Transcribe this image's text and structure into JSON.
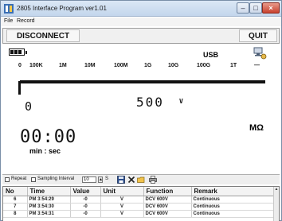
{
  "window": {
    "title": "2805 Interface Program ver1.01"
  },
  "menu": [
    "File",
    "Record"
  ],
  "toolbar": {
    "disconnect_label": "DISCONNECT",
    "quit_label": "QUIT"
  },
  "display": {
    "battery_icon": "battery-icon",
    "usb_label": "USB",
    "scale_labels": [
      "0",
      "100K",
      "1M",
      "10M",
      "100M",
      "1G",
      "10G",
      "100G",
      "1T",
      "—"
    ],
    "range_digit": "0",
    "voltage_value": "500",
    "voltage_unit": "V",
    "timer_value": "00:00",
    "timer_caption": "min : sec",
    "resistance_unit": "MΩ"
  },
  "options": {
    "repeat_label": "Repeat",
    "sampling_label": "Sampling Interval",
    "interval_value": "10",
    "interval_unit": "S"
  },
  "table": {
    "columns": [
      "No",
      "Time",
      "Value",
      "Unit",
      "Function",
      "Remark"
    ],
    "rows": [
      [
        "6",
        "PM 3:54:29",
        "-0",
        "V",
        "DCV 600V",
        "Continuous"
      ],
      [
        "7",
        "PM 3:54:30",
        "-0",
        "V",
        "DCV 600V",
        "Continuous"
      ],
      [
        "8",
        "PM 3:54:31",
        "-0",
        "V",
        "DCV 600V",
        "Continuous"
      ]
    ]
  }
}
